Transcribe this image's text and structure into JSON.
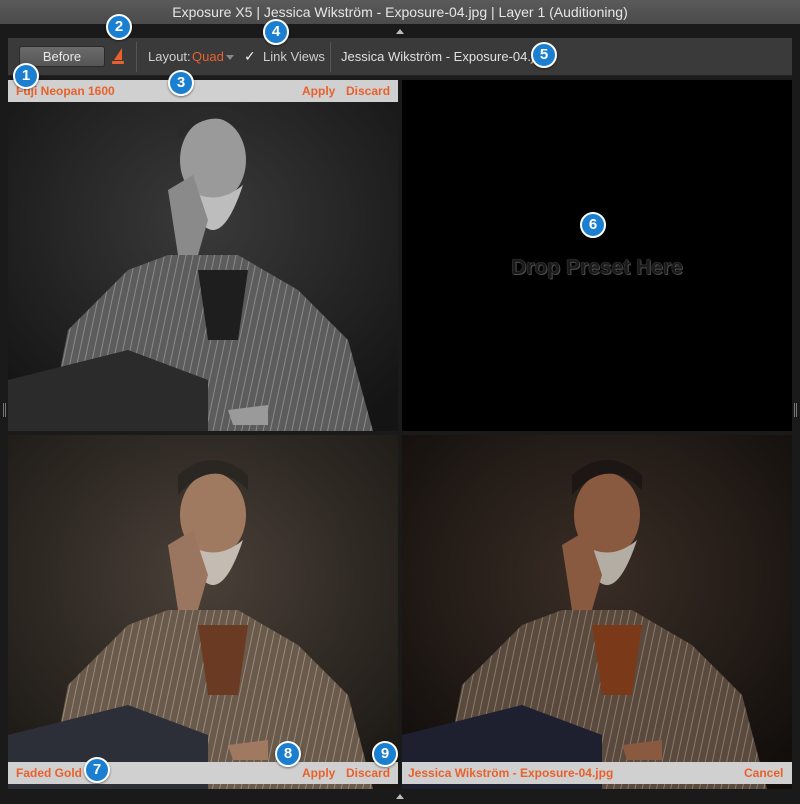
{
  "window": {
    "title": "Exposure X5 | Jessica Wikström - Exposure-04.jpg | Layer 1 (Auditioning)"
  },
  "toolbar": {
    "before_label": "Before",
    "layout_label": "Layout:",
    "layout_value": "Quad",
    "link_views_check": "✓",
    "link_views_label": "Link Views",
    "filename": "Jessica Wikström - Exposure-04.jpg"
  },
  "panes": {
    "top_left": {
      "preset": "Fuji Neopan 1600",
      "apply": "Apply",
      "discard": "Discard"
    },
    "top_right": {
      "drop_text": "Drop Preset Here"
    },
    "bottom_left": {
      "preset": "Faded Gold",
      "apply": "Apply",
      "discard": "Discard"
    },
    "bottom_right": {
      "label": "Jessica Wikström - Exposure-04.jpg",
      "cancel": "Cancel"
    }
  },
  "callouts": [
    "1",
    "2",
    "3",
    "4",
    "5",
    "6",
    "7",
    "8",
    "9"
  ],
  "colors": {
    "accent": "#e8612c",
    "callout": "#1a7fd0",
    "bar": "#d0d0d0"
  }
}
